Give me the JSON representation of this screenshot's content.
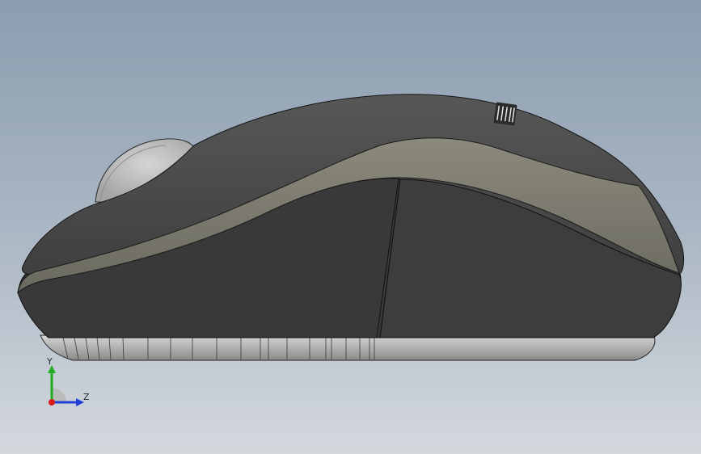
{
  "viewport": {
    "background_top": "#8b9db0",
    "background_bottom": "#d3d8dd"
  },
  "model": {
    "shell_color": "#3b3b3b",
    "accent_band_color": "#7b7a6e",
    "base_color": "#b9b9b9",
    "wheel_color": "#c6c6c6"
  },
  "triad": {
    "y_label": "Y",
    "z_label": "Z",
    "y_color": "#22aa22",
    "z_color": "#1f3fd6",
    "origin_color": "#d81c1c"
  }
}
